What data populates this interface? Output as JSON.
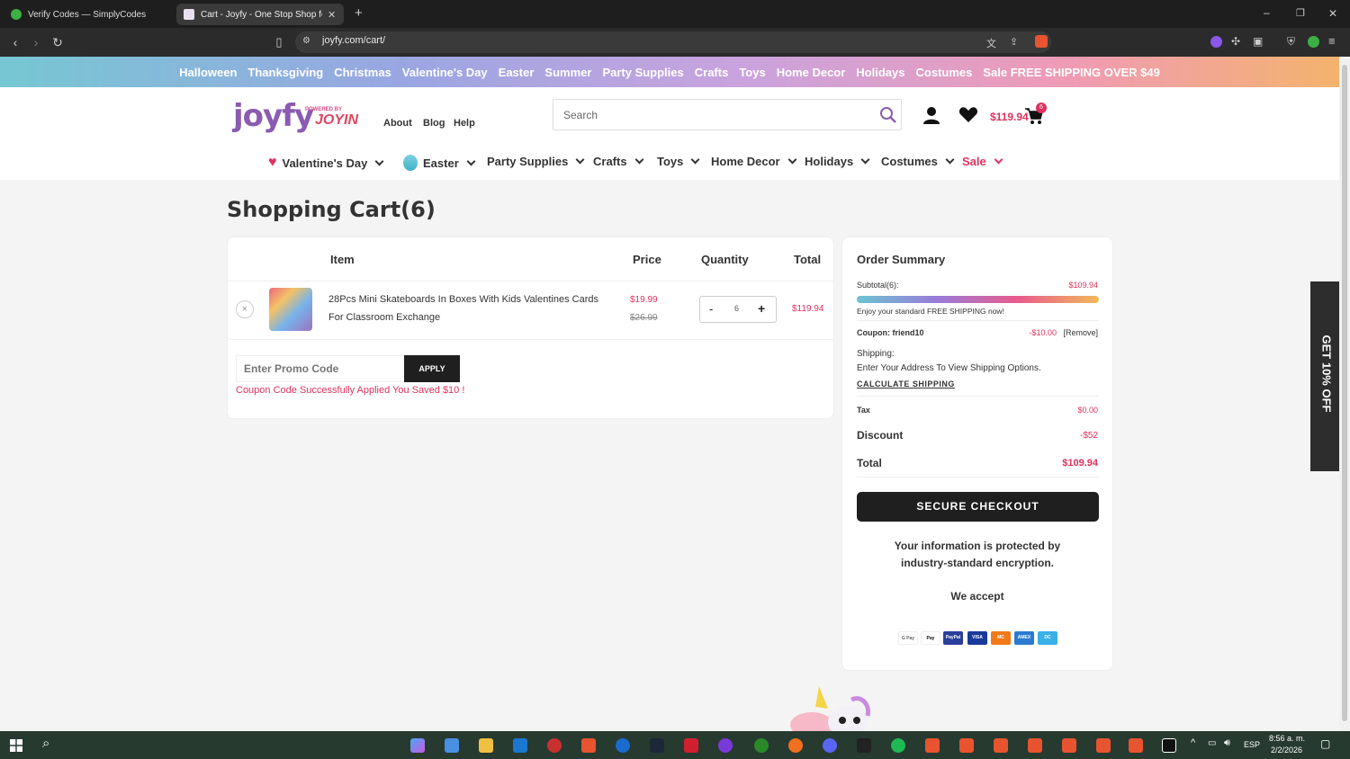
{
  "browser": {
    "tabs": [
      {
        "title": "Verify Codes — SimplyCodes",
        "active": false
      },
      {
        "title": "Cart - Joyfy - One Stop Shop for",
        "active": true
      }
    ],
    "new_tab": "+",
    "url": "joyfy.com/cart/",
    "window_controls": [
      "–",
      "❐",
      "✕"
    ]
  },
  "promo_bar": [
    "Halloween",
    "Thanksgiving",
    "Christmas",
    "Valentine's Day",
    "Easter",
    "Summer",
    "Party Supplies",
    "Crafts",
    "Toys",
    "Home Decor",
    "Holidays",
    "Costumes",
    "Sale FREE SHIPPING OVER $49"
  ],
  "header": {
    "logo": "joyfy",
    "logo_powered": "POWERED BY",
    "logo_joyin": "JOYIN",
    "links": [
      "About",
      "Blog",
      "Help"
    ],
    "search_placeholder": "Search",
    "cart_amount": "$119.94",
    "cart_count": "6"
  },
  "nav": [
    "Valentine's Day",
    "Easter",
    "Party Supplies",
    "Crafts",
    "Toys",
    "Home Decor",
    "Holidays",
    "Costumes",
    "Sale"
  ],
  "cart": {
    "title": "Shopping Cart(6)",
    "headers": {
      "item": "Item",
      "price": "Price",
      "quantity": "Quantity",
      "total": "Total"
    },
    "items": [
      {
        "name_line1": "28Pcs Mini Skateboards In Boxes With Kids Valentines Cards",
        "name_line2": "For Classroom Exchange",
        "price": "$19.99",
        "old_price": "$26.99",
        "qty": "6",
        "total": "$119.94"
      }
    ],
    "remove_symbol": "×",
    "qty_minus": "-",
    "qty_plus": "+",
    "promo_placeholder": "Enter Promo Code",
    "apply_label": "APPLY",
    "promo_message": "Coupon Code Successfully Applied You Saved $10 !"
  },
  "summary": {
    "title": "Order Summary",
    "subtotal_label": "Subtotal(6):",
    "subtotal_value": "$109.94",
    "shipping_progress": 1.0,
    "free_shipping_msg": "Enjoy your standard FREE SHIPPING now!",
    "coupon_label": "Coupon: friend10",
    "coupon_value": "-$10.00",
    "coupon_remove": "[Remove]",
    "shipping_label": "Shipping:",
    "shipping_msg": "Enter Your Address To View Shipping Options.",
    "calc_shipping": "CALCULATE SHIPPING",
    "tax_label": "Tax",
    "tax_value": "$0.00",
    "discount_label": "Discount",
    "discount_value": "-$52",
    "total_label": "Total",
    "total_value": "$109.94",
    "checkout_label": "SECURE CHECKOUT",
    "secure_line1": "Your information is protected by",
    "secure_line2": "industry-standard encryption.",
    "we_accept": "We accept",
    "payment_methods": [
      "G Pay",
      "Pay",
      "PayPal",
      "VISA",
      "MC",
      "AMEX",
      "DC"
    ]
  },
  "side_tab": "GET 10% OFF",
  "taskbar": {
    "lang": "ESP",
    "time": "8:56 a. m.",
    "date": "2/2/2026"
  },
  "colors": {
    "accent_pink": "#e0325f",
    "purple": "#8a5bb0",
    "dark": "#1f1f1f"
  }
}
